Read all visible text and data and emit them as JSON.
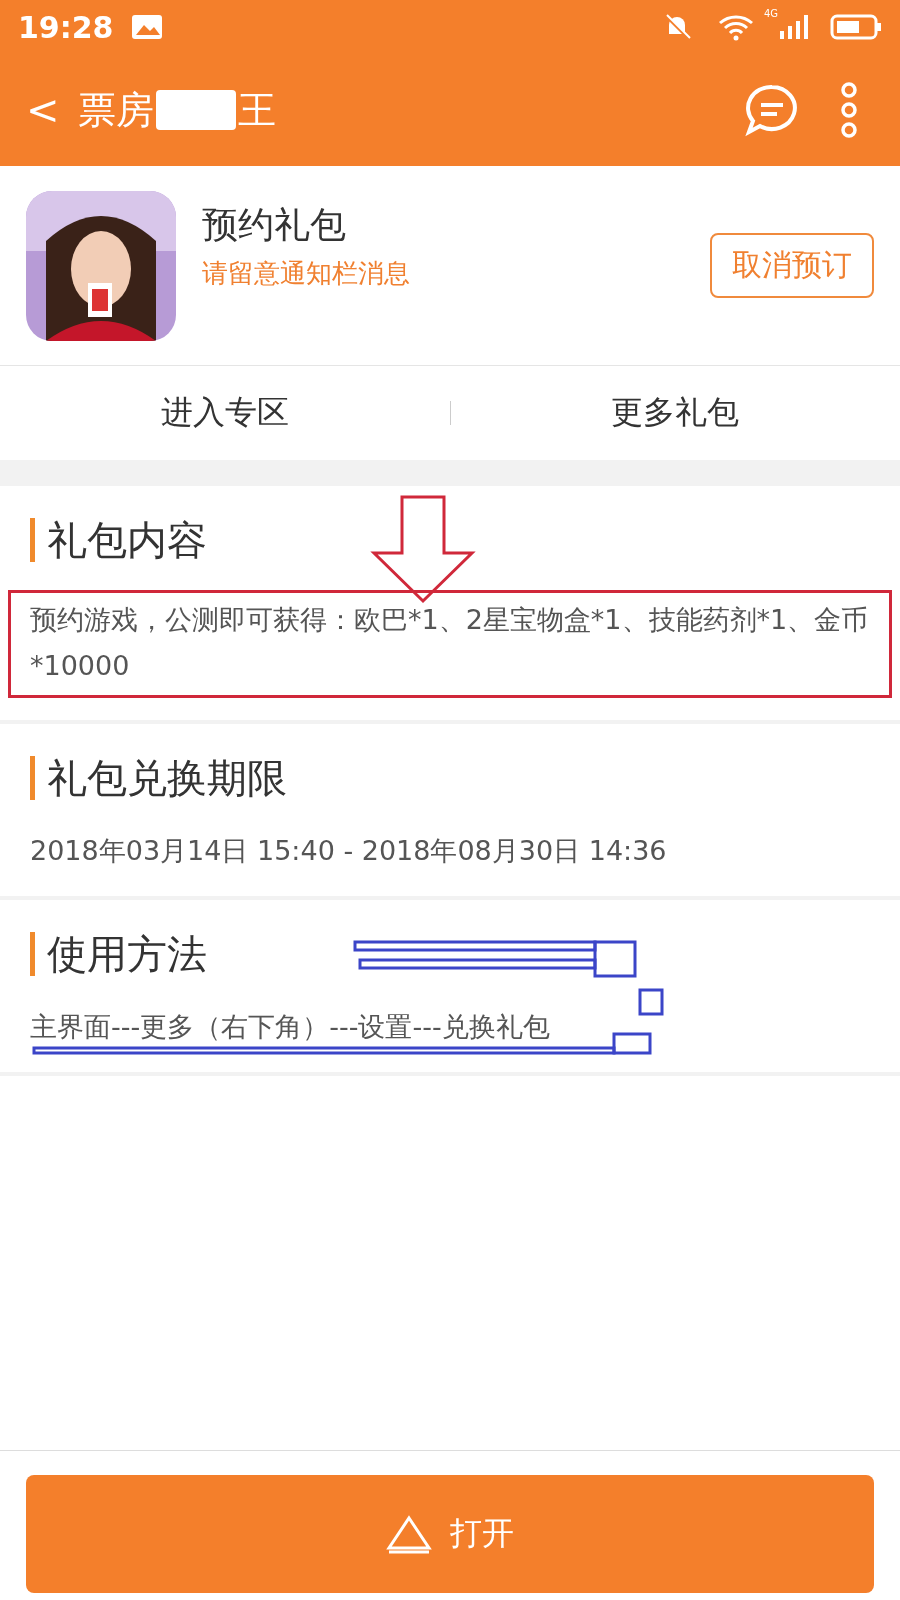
{
  "status_bar": {
    "time": "19:28",
    "network": "4G"
  },
  "header": {
    "back": "<",
    "title_start": "票房",
    "title_end": "王"
  },
  "app": {
    "title": "预约礼包",
    "subtitle": "请留意通知栏消息",
    "action": "取消预订"
  },
  "links": [
    {
      "label": "进入专区"
    },
    {
      "label": "更多礼包"
    }
  ],
  "sections": [
    {
      "heading": "礼包内容",
      "text": "预约游戏，公测即可获得：欧巴*1、2星宝物盒*1、技能药剂*1、金币*10000",
      "marked": true
    },
    {
      "heading": "礼包兑换期限",
      "text": "2018年03月14日 15:40 - 2018年08月30日 14:36",
      "marked": false
    },
    {
      "heading": "使用方法",
      "text": "主界面---更多（右下角）---设置---兑换礼包",
      "scribbled": true
    }
  ],
  "open_button": {
    "label": "打开"
  }
}
